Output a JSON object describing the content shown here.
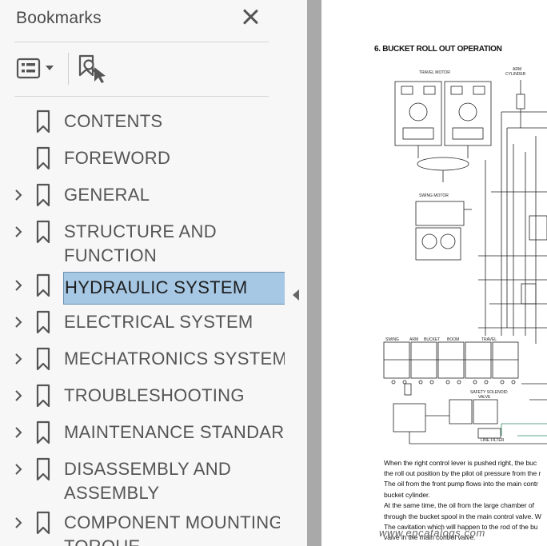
{
  "sidebar": {
    "title": "Bookmarks",
    "items": [
      {
        "label": "CONTENTS",
        "expandable": false
      },
      {
        "label": "FOREWORD",
        "expandable": false
      },
      {
        "label": "GENERAL",
        "expandable": true
      },
      {
        "label": "STRUCTURE AND",
        "label2": "FUNCTION",
        "expandable": true
      },
      {
        "label": "HYDRAULIC SYSTEM",
        "expandable": true,
        "selected": true
      },
      {
        "label": "ELECTRICAL SYSTEM",
        "expandable": true
      },
      {
        "label": "MECHATRONICS SYSTEM",
        "expandable": true
      },
      {
        "label": "TROUBLESHOOTING",
        "expandable": true
      },
      {
        "label": "MAINTENANCE STANDARD",
        "expandable": true
      },
      {
        "label": "DISASSEMBLY AND",
        "label2": "ASSEMBLY",
        "expandable": true
      },
      {
        "label": "COMPONENT MOUNTING",
        "label2": "TORQUE",
        "expandable": true
      }
    ]
  },
  "icons": {
    "close": "close-icon",
    "options": "bookmark-options-icon",
    "find": "find-current-bookmark-icon",
    "bookmark": "bookmark-ribbon-icon",
    "expand": "chevron-right-icon",
    "collapse": "collapse-triangle-left-icon"
  },
  "colors": {
    "selection_fill": "#a6c8e4",
    "selection_border": "#6a8fb0",
    "panel_bg": "#f7f7f7",
    "doc_bg": "#a9a9a9"
  },
  "document": {
    "heading": "6. BUCKET ROLL OUT OPERATION",
    "diagram_labels": {
      "travel_motor": "TRAVEL MOTOR",
      "arm_cylinder_1": "ARM",
      "arm_cylinder_2": "CYLINDER",
      "swing_motor": "SWING MOTOR",
      "swing": "SWING",
      "arm": "ARM",
      "bucket": "BUCKET",
      "boom": "BOOM",
      "travel": "TRAVEL",
      "safety_solenoid_1": "SAFETY SOLENOID",
      "safety_solenoid_2": "VALVE",
      "line_filter": "LINE FILTER"
    },
    "body_lines": [
      "When the right control lever is pushed right, the buc",
      "the roll out position by the pilot oil pressure from the r",
      "The oil from the front pump flows into the main contr",
      "bucket cylinder.",
      "At the same time, the oil from the large chamber of",
      "through the bucket spool in the main control valve. W",
      "The cavitation which will happen to the rod of the bu",
      "valve in the main control valve."
    ],
    "watermark": "www.epcatalogs.com"
  }
}
